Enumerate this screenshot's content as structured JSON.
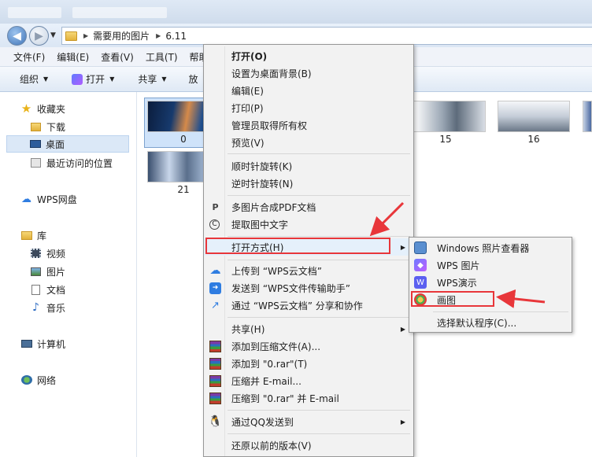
{
  "titlebar": {
    "tabs": [
      "",
      ""
    ]
  },
  "address": {
    "crumbs": [
      "需要用的图片",
      "6.11"
    ]
  },
  "menubar": {
    "items": [
      "文件(F)",
      "编辑(E)",
      "查看(V)",
      "工具(T)",
      "帮助"
    ]
  },
  "toolbar": {
    "organize": "组织",
    "open": "打开",
    "share": "共享",
    "partial": "放"
  },
  "sidebar": {
    "favorites": "收藏夹",
    "downloads": "下载",
    "desktop": "桌面",
    "recent": "最近访问的位置",
    "wps_disk": "WPS网盘",
    "library": "库",
    "videos": "视频",
    "pictures": "图片",
    "documents": "文档",
    "music": "音乐",
    "computer": "计算机",
    "network": "网络"
  },
  "thumbnails": [
    {
      "label": "0"
    },
    {
      "label": "21"
    },
    {
      "label": "15"
    },
    {
      "label": "16"
    }
  ],
  "context_menu": {
    "open": "打开(O)",
    "set_wallpaper": "设置为桌面背景(B)",
    "edit": "编辑(E)",
    "print": "打印(P)",
    "take_ownership": "管理员取得所有权",
    "preview": "预览(V)",
    "rotate_cw": "顺时针旋转(K)",
    "rotate_ccw": "逆时针旋转(N)",
    "merge_pdf": "多图片合成PDF文档",
    "extract_text": "提取图中文字",
    "open_with": "打开方式(H)",
    "upload_cloud": "上传到 “WPS云文档”",
    "send_transfer": "发送到 “WPS文件传输助手”",
    "share_collab": "通过 “WPS云文档” 分享和协作",
    "share": "共享(H)",
    "add_archive": "添加到压缩文件(A)...",
    "add_rar": "添加到 \"0.rar\"(T)",
    "compress_email": "压缩并 E-mail...",
    "compress_rar_email": "压缩到 \"0.rar\" 并 E-mail",
    "send_qq": "通过QQ发送到",
    "restore_version": "还原以前的版本(V)"
  },
  "submenu": {
    "photo_viewer": "Windows 照片查看器",
    "wps_pictures": "WPS 图片",
    "wps_presentation": "WPS演示",
    "paint": "画图",
    "choose_default": "选择默认程序(C)..."
  },
  "colors": {
    "highlight": "#e8363a",
    "selection": "#cfe3fa"
  }
}
